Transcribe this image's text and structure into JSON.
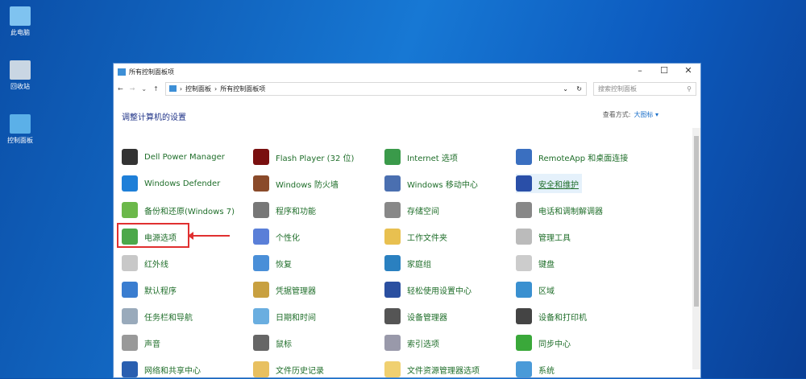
{
  "desktop": [
    {
      "label": "此电脑",
      "color": "#7fc3f0"
    },
    {
      "label": "回收站",
      "color": "#c9d6e3"
    },
    {
      "label": "控制面板",
      "color": "#5bb0e8"
    }
  ],
  "window": {
    "title": "所有控制面板项",
    "minimize": "–",
    "maximize": "☐",
    "close": "✕"
  },
  "address": {
    "back": "←",
    "forward": "→",
    "recent": "⌄",
    "up": "↑",
    "crumbs": [
      "控制面板",
      "所有控制面板项"
    ],
    "sep": "›",
    "dropdown": "⌄",
    "refresh": "↻",
    "search_placeholder": "搜索控制面板",
    "search_icon": "⚲"
  },
  "header": {
    "title": "调整计算机的设置",
    "view_label": "查看方式:",
    "view_value": "大图标 ▾"
  },
  "columns": [
    [
      {
        "label": "Dell Power Manager",
        "color": "#333"
      },
      {
        "label": "Windows Defender",
        "color": "#1e7fd8"
      },
      {
        "label": "备份和还原(Windows 7)",
        "color": "#6bb84a"
      },
      {
        "label": "电源选项",
        "color": "#4ca84a"
      },
      {
        "label": "红外线",
        "color": "#c8c8c8"
      },
      {
        "label": "默认程序",
        "color": "#3a7dd0"
      },
      {
        "label": "任务栏和导航",
        "color": "#9ab"
      },
      {
        "label": "声音",
        "color": "#999"
      },
      {
        "label": "网络和共享中心",
        "color": "#2a5fb0"
      }
    ],
    [
      {
        "label": "Flash Player (32 位)",
        "color": "#7a1010"
      },
      {
        "label": "Windows 防火墙",
        "color": "#8a4a2a"
      },
      {
        "label": "程序和功能",
        "color": "#777"
      },
      {
        "label": "个性化",
        "color": "#5a7fd8"
      },
      {
        "label": "恢复",
        "color": "#4a8fd8"
      },
      {
        "label": "凭据管理器",
        "color": "#c8a040"
      },
      {
        "label": "日期和时间",
        "color": "#6aaee0"
      },
      {
        "label": "鼠标",
        "color": "#666"
      },
      {
        "label": "文件历史记录",
        "color": "#e8c060"
      }
    ],
    [
      {
        "label": "Internet 选项",
        "color": "#3a9a4a"
      },
      {
        "label": "Windows 移动中心",
        "color": "#4a6fb0"
      },
      {
        "label": "存储空间",
        "color": "#888"
      },
      {
        "label": "工作文件夹",
        "color": "#e8c050"
      },
      {
        "label": "家庭组",
        "color": "#2a80c0"
      },
      {
        "label": "轻松使用设置中心",
        "color": "#2a4fa0"
      },
      {
        "label": "设备管理器",
        "color": "#555"
      },
      {
        "label": "索引选项",
        "color": "#99a"
      },
      {
        "label": "文件资源管理器选项",
        "color": "#f0d070"
      }
    ],
    [
      {
        "label": "RemoteApp 和桌面连接",
        "color": "#3a6fc0"
      },
      {
        "label": "安全和维护",
        "color": "#2a4fa8"
      },
      {
        "label": "电话和调制解调器",
        "color": "#888"
      },
      {
        "label": "管理工具",
        "color": "#bbb"
      },
      {
        "label": "键盘",
        "color": "#ccc"
      },
      {
        "label": "区域",
        "color": "#3a90d0"
      },
      {
        "label": "设备和打印机",
        "color": "#444"
      },
      {
        "label": "同步中心",
        "color": "#3aa83a"
      },
      {
        "label": "系统",
        "color": "#4a9ad8"
      }
    ]
  ]
}
